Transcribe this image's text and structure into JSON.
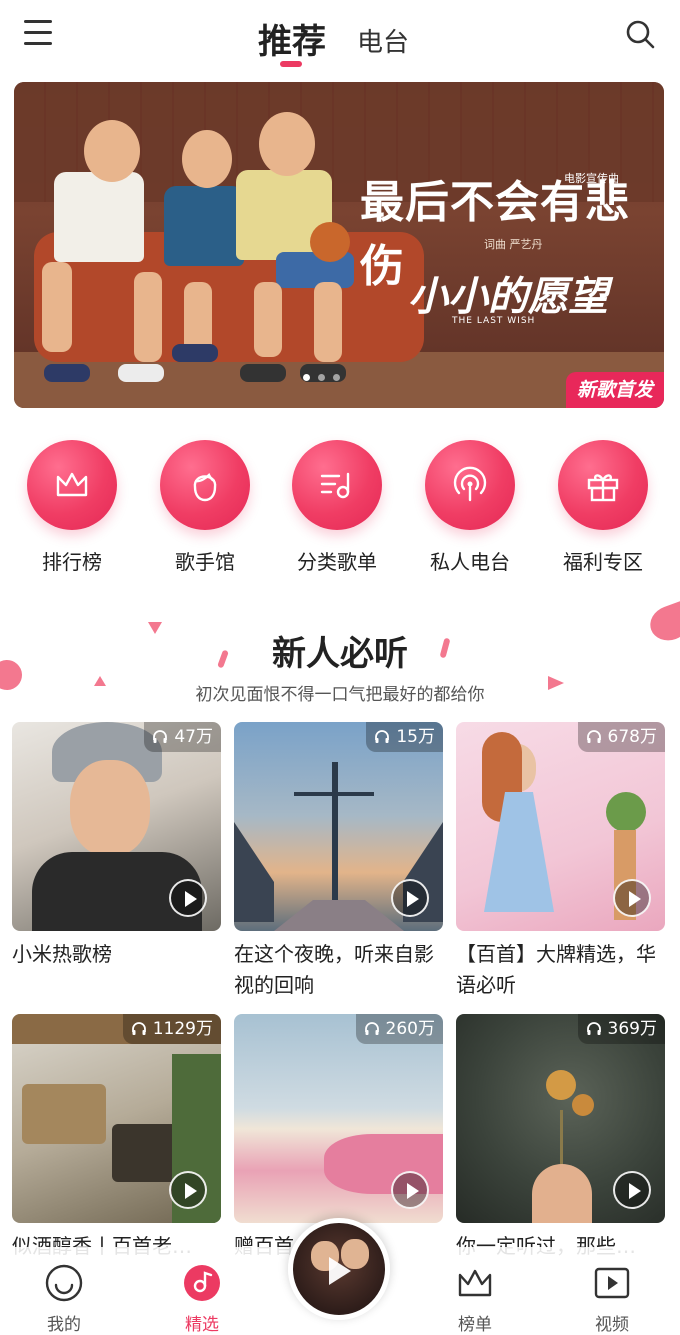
{
  "header": {
    "tabs": [
      {
        "label": "推荐",
        "active": true
      },
      {
        "label": "电台",
        "active": false
      }
    ],
    "icons": [
      "menu-icon",
      "search-icon"
    ],
    "accent_color": "#ec3a62"
  },
  "banner": {
    "title": "最后不会有悲伤",
    "tag": "电影宣传曲",
    "credit": "词曲 严艺丹",
    "movie_title": "小小的愿望",
    "movie_title_en": "THE LAST WISH",
    "badge": "新歌首发",
    "slide_count": 3,
    "active_slide": 1
  },
  "quick_nav": [
    {
      "label": "排行榜",
      "icon": "crown-icon"
    },
    {
      "label": "歌手馆",
      "icon": "singer-face-icon"
    },
    {
      "label": "分类歌单",
      "icon": "playlist-icon"
    },
    {
      "label": "私人电台",
      "icon": "radio-icon"
    },
    {
      "label": "福利专区",
      "icon": "gift-icon"
    }
  ],
  "section": {
    "title": "新人必听",
    "subtitle": "初次见面恨不得一口气把最好的都给你"
  },
  "playlists": [
    {
      "title": "小米热歌榜",
      "plays": "47万"
    },
    {
      "title": "在这个夜晚，听来自影视的回响",
      "plays": "15万"
    },
    {
      "title": "【百首】大牌精选，华语必听",
      "plays": "678万"
    },
    {
      "title": "似酒醇香丨百首老…",
      "plays": "1129万"
    },
    {
      "title": "赠百首…夏白…",
      "plays": "260万"
    },
    {
      "title": "你一定听过，那些…",
      "plays": "369万"
    }
  ],
  "bottom_nav": [
    {
      "label": "我的",
      "icon": "smiley-icon",
      "active": false
    },
    {
      "label": "精选",
      "icon": "music-disc-icon",
      "active": true
    },
    {
      "label": "榜单",
      "icon": "crown-icon",
      "active": false
    },
    {
      "label": "视频",
      "icon": "video-icon",
      "active": false
    }
  ]
}
